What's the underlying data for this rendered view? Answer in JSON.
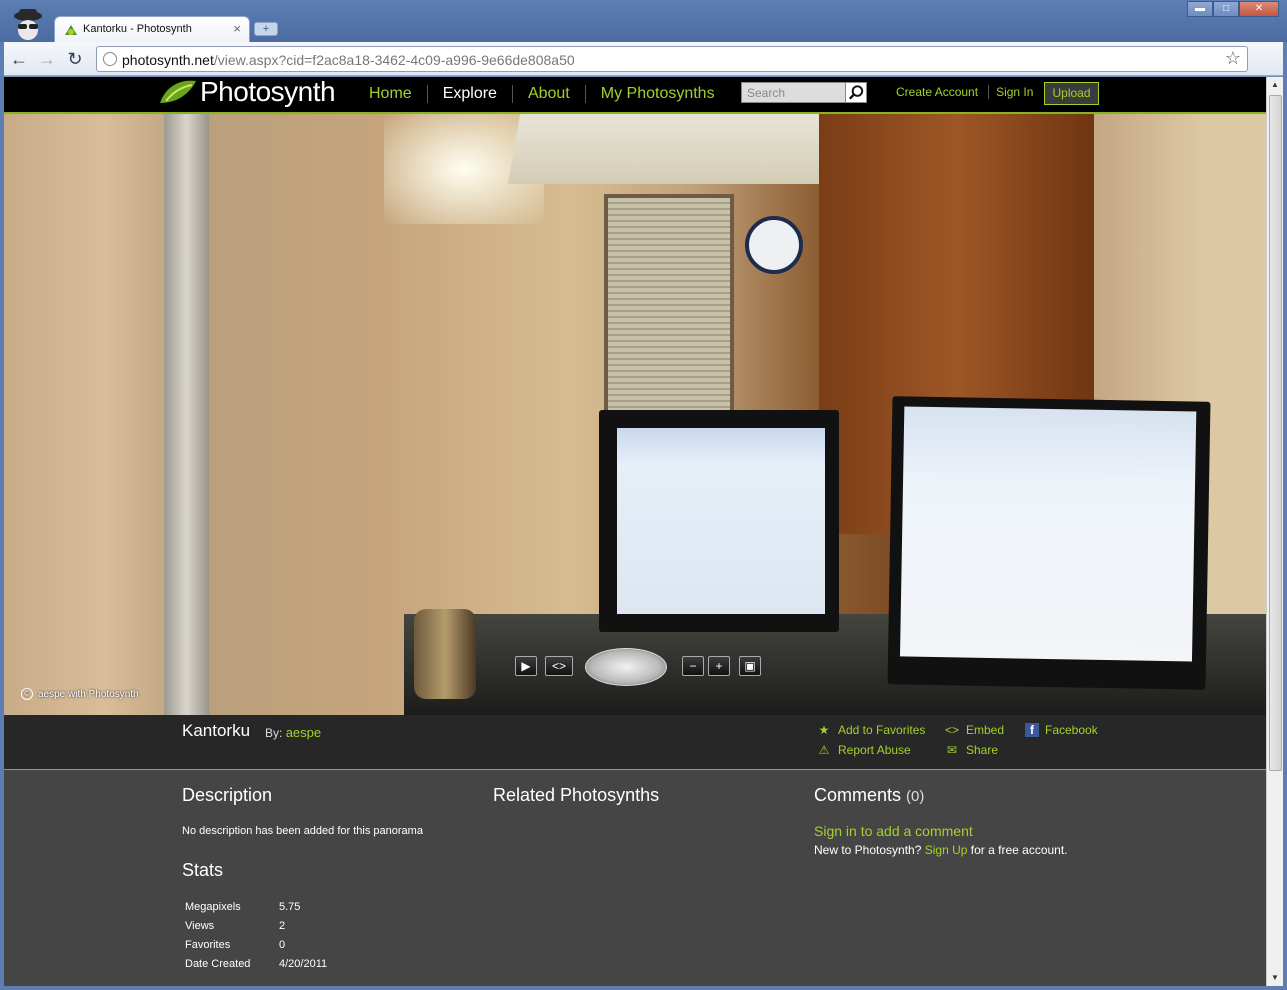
{
  "browser": {
    "tab_title": "Kantorku - Photosynth",
    "tab_close": "×",
    "new_tab": "+",
    "url_host": "photosynth.net",
    "url_path": "/view.aspx?cid=f2ac8a18-3462-4c09-a996-9e66de808a50",
    "window_controls": {
      "minimize": "▬",
      "maximize": "□",
      "close": "✕"
    }
  },
  "site": {
    "logo_text": "Photosynth",
    "nav": [
      {
        "label": "Home",
        "active": false
      },
      {
        "label": "Explore",
        "active": true
      },
      {
        "label": "About",
        "active": false
      },
      {
        "label": "My Photosynths",
        "active": false
      }
    ],
    "search_placeholder": "Search",
    "account_links": [
      "Create Account",
      "Sign In"
    ],
    "upload_label": "Upload",
    "accent_color": "#a3d12b"
  },
  "viewer": {
    "credit": "aespe with Photosynth",
    "credit_icon": "©"
  },
  "synth": {
    "title": "Kantorku",
    "by_label": "By:",
    "author": "aespe",
    "actions": {
      "add_to_favorites": "Add to Favorites",
      "embed": "Embed",
      "facebook": "Facebook",
      "report_abuse": "Report Abuse",
      "share": "Share"
    }
  },
  "description": {
    "heading": "Description",
    "text": "No description has been added for this panorama"
  },
  "stats": {
    "heading": "Stats",
    "rows": [
      {
        "label": "Megapixels",
        "value": "5.75"
      },
      {
        "label": "Views",
        "value": "2"
      },
      {
        "label": "Favorites",
        "value": "0"
      },
      {
        "label": "Date Created",
        "value": "4/20/2011"
      }
    ]
  },
  "related": {
    "heading": "Related Photosynths"
  },
  "comments": {
    "heading": "Comments",
    "count": "(0)",
    "sign_in_prompt": "Sign in to add a comment",
    "new_to_text": "New to Photosynth?",
    "sign_up_link": "Sign Up",
    "free_account_text": "for a free account."
  }
}
